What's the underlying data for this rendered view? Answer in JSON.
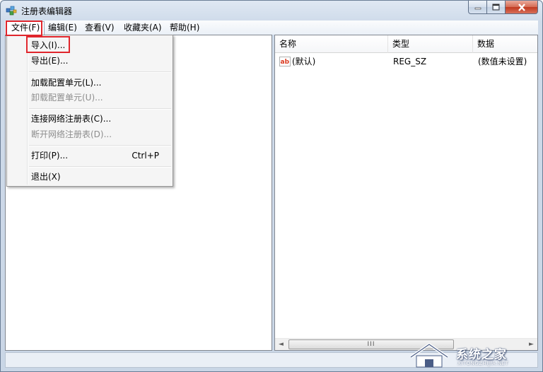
{
  "window": {
    "title": "注册表编辑器"
  },
  "menubar": {
    "items": [
      {
        "label": "文件(F)"
      },
      {
        "label": "编辑(E)"
      },
      {
        "label": "查看(V)"
      },
      {
        "label": "收藏夹(A)"
      },
      {
        "label": "帮助(H)"
      }
    ]
  },
  "file_menu": {
    "items": [
      {
        "label": "导入(I)...",
        "enabled": true
      },
      {
        "label": "导出(E)...",
        "enabled": true
      },
      {
        "label": "加载配置单元(L)...",
        "enabled": true
      },
      {
        "label": "卸载配置单元(U)...",
        "enabled": false
      },
      {
        "label": "连接网络注册表(C)...",
        "enabled": true
      },
      {
        "label": "断开网络注册表(D)...",
        "enabled": false
      },
      {
        "label": "打印(P)...",
        "shortcut": "Ctrl+P",
        "enabled": true
      },
      {
        "label": "退出(X)",
        "enabled": true
      }
    ]
  },
  "values_pane": {
    "columns": [
      "名称",
      "类型",
      "数据"
    ],
    "rows": [
      {
        "icon": "ab-string-icon",
        "name": "(默认)",
        "type": "REG_SZ",
        "data": "(数值未设置)"
      }
    ]
  },
  "scrollbar": {
    "thumb_grip": "III"
  },
  "watermark": {
    "text": "系统之家",
    "sub": "XITONGZHIJIA.NET"
  },
  "highlight_color": "#e0262c"
}
